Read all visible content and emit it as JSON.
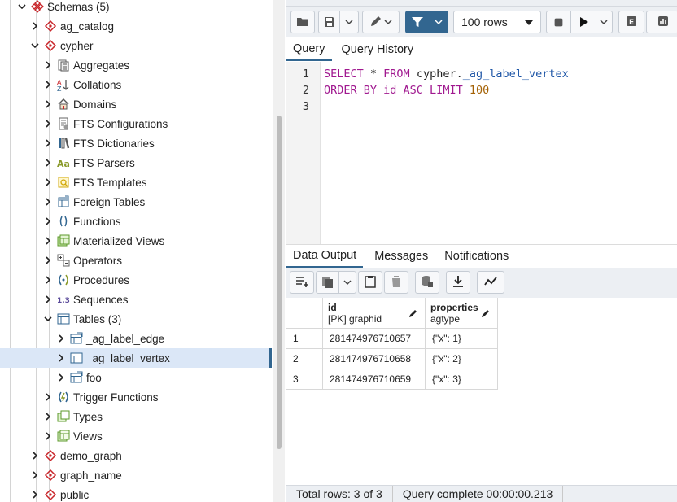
{
  "tree": {
    "items": [
      {
        "label": "Schemas (5)",
        "icon": "schemas-icon",
        "expanded": true
      },
      {
        "label": "ag_catalog",
        "icon": "schema-icon",
        "expanded": false
      },
      {
        "label": "cypher",
        "icon": "schema-icon",
        "expanded": true
      },
      {
        "label": "Aggregates",
        "icon": "aggregates-icon",
        "expanded": false
      },
      {
        "label": "Collations",
        "icon": "collations-icon",
        "expanded": false
      },
      {
        "label": "Domains",
        "icon": "domains-icon",
        "expanded": false
      },
      {
        "label": "FTS Configurations",
        "icon": "fts-configurations-icon",
        "expanded": false
      },
      {
        "label": "FTS Dictionaries",
        "icon": "fts-dictionaries-icon",
        "expanded": false
      },
      {
        "label": "FTS Parsers",
        "icon": "fts-parsers-icon",
        "expanded": false
      },
      {
        "label": "FTS Templates",
        "icon": "fts-templates-icon",
        "expanded": false
      },
      {
        "label": "Foreign Tables",
        "icon": "foreign-tables-icon",
        "expanded": false
      },
      {
        "label": "Functions",
        "icon": "functions-icon",
        "expanded": false
      },
      {
        "label": "Materialized Views",
        "icon": "materialized-views-icon",
        "expanded": false
      },
      {
        "label": "Operators",
        "icon": "operators-icon",
        "expanded": false
      },
      {
        "label": "Procedures",
        "icon": "procedures-icon",
        "expanded": false
      },
      {
        "label": "Sequences",
        "icon": "sequences-icon",
        "expanded": false
      },
      {
        "label": "Tables (3)",
        "icon": "tables-icon",
        "expanded": true
      },
      {
        "label": "_ag_label_edge",
        "icon": "table-icon",
        "expanded": false
      },
      {
        "label": "_ag_label_vertex",
        "icon": "table-icon",
        "expanded": false,
        "selected": true
      },
      {
        "label": "foo",
        "icon": "table-icon",
        "expanded": false
      },
      {
        "label": "Trigger Functions",
        "icon": "trigger-functions-icon",
        "expanded": false
      },
      {
        "label": "Types",
        "icon": "types-icon",
        "expanded": false
      },
      {
        "label": "Views",
        "icon": "views-icon",
        "expanded": false
      },
      {
        "label": "demo_graph",
        "icon": "schema-icon",
        "expanded": false
      },
      {
        "label": "graph_name",
        "icon": "schema-icon",
        "expanded": false
      },
      {
        "label": "public",
        "icon": "schema-icon",
        "expanded": false
      }
    ]
  },
  "toolbar": {
    "rows_limit": "100 rows",
    "icons": [
      "folder-icon",
      "save-icon",
      "chevron-down-icon",
      "pencil-icon",
      "filter-icon",
      "stop-icon",
      "play-icon",
      "explain-icon",
      "explain-analyze-icon"
    ]
  },
  "query_tabs": [
    "Query",
    "Query History"
  ],
  "editor": {
    "line_numbers": [
      "1",
      "2",
      "3"
    ],
    "line1": {
      "kw1": "SELECT",
      "star": " * ",
      "kw2": "FROM",
      "schema": " cypher.",
      "obj": "_ag_label_vertex"
    },
    "line2": {
      "kw1": "ORDER BY",
      "col": " id ",
      "kw2": "ASC LIMIT",
      "num": " 100"
    }
  },
  "output_tabs": [
    "Data Output",
    "Messages",
    "Notifications"
  ],
  "output_toolbar": {
    "icons": [
      "add-row-icon",
      "copy-icon",
      "chevron-down-icon",
      "paste-icon",
      "delete-icon",
      "save-data-icon",
      "download-icon",
      "graph-icon"
    ]
  },
  "result": {
    "columns": [
      {
        "name": "id",
        "type": "[PK] graphid"
      },
      {
        "name": "properties",
        "type": "agtype"
      }
    ],
    "rows": [
      {
        "n": "1",
        "id": "281474976710657",
        "properties": "{\"x\": 1}"
      },
      {
        "n": "2",
        "id": "281474976710658",
        "properties": "{\"x\": 2}"
      },
      {
        "n": "3",
        "id": "281474976710659",
        "properties": "{\"x\": 3}"
      }
    ]
  },
  "status": {
    "total_rows": "Total rows: 3 of 3",
    "query_complete": "Query complete 00:00:00.213"
  },
  "colors": {
    "accent": "#326690",
    "keyword": "#a0188f",
    "object": "#1d55a6",
    "number": "#a46206",
    "selected_row": "#dbe7f7",
    "schema_red": "#c9252a"
  }
}
